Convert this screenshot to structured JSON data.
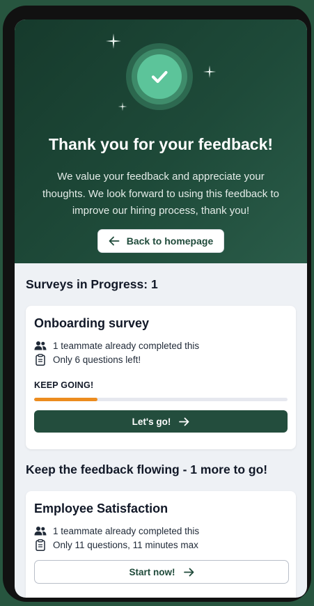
{
  "hero": {
    "title": "Thank you for your feedback!",
    "message": "We value your feedback and appreciate your thoughts. We look forward to using this feedback to improve our hiring process, thank you!",
    "back_button_label": "Back to homepage",
    "icons": {
      "badge": "check-circle-icon",
      "sparkle": "sparkle-icon",
      "back": "arrow-left-icon"
    }
  },
  "in_progress": {
    "heading": "Surveys in Progress: 1",
    "survey": {
      "title": "Onboarding survey",
      "teammates_text": "1 teammate already completed this",
      "questions_text": "Only 6 questions left!",
      "progress_label": "KEEP GOING!",
      "progress_fraction": 0.25,
      "button_label": "Let's go!"
    }
  },
  "more": {
    "heading": "Keep the feedback flowing - 1 more to go!",
    "survey": {
      "title": "Employee Satisfaction",
      "teammates_text": "1 teammate already completed this",
      "questions_text": "Only 11 questions, 11 minutes max",
      "button_label": "Start now!"
    }
  },
  "colors": {
    "hero_bg": "#1e4a39",
    "badge": "#5cc49a",
    "primary": "#234d3d",
    "progress": "#ec8c1f",
    "background": "#eef1f5"
  }
}
